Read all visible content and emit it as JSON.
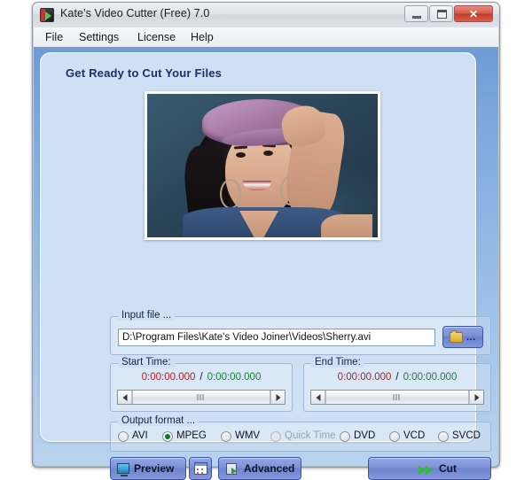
{
  "window": {
    "title": "Kate's Video Cutter (Free) 7.0",
    "controls": {
      "minimize": "–",
      "maximize": "□",
      "close": "✕"
    }
  },
  "menu": [
    {
      "label": "File"
    },
    {
      "label": "Settings"
    },
    {
      "label": "License"
    },
    {
      "label": "Help"
    }
  ],
  "main": {
    "headline": "Get Ready to Cut Your Files",
    "input": {
      "group_title": "Input file ...",
      "path": "D:\\Program Files\\Kate's Video Joiner\\Videos\\Sherry.avi",
      "browse_dots": "..."
    },
    "start_time": {
      "group_title": "Start Time:",
      "current": "0:00:00.000",
      "separator": "/",
      "total": "0:00:00.000"
    },
    "end_time": {
      "group_title": "End Time:",
      "current": "0:00:00.000",
      "separator": "/",
      "total": "0:00:00.000"
    },
    "output": {
      "group_title": "Output format ...",
      "options": [
        {
          "label": "AVI",
          "selected": false,
          "disabled": false
        },
        {
          "label": "MPEG",
          "selected": true,
          "disabled": false
        },
        {
          "label": "WMV",
          "selected": false,
          "disabled": false
        },
        {
          "label": "Quick Time",
          "selected": false,
          "disabled": true
        },
        {
          "label": "DVD",
          "selected": false,
          "disabled": false
        },
        {
          "label": "VCD",
          "selected": false,
          "disabled": false
        },
        {
          "label": "SVCD",
          "selected": false,
          "disabled": false
        }
      ]
    },
    "buttons": {
      "preview": "Preview",
      "advanced": "Advanced",
      "cut": "Cut"
    }
  }
}
